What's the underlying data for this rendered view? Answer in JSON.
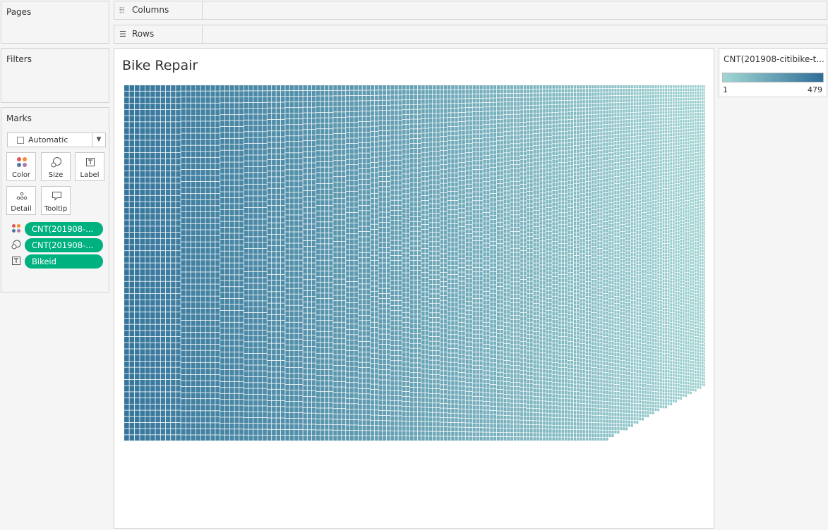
{
  "pages": {
    "title": "Pages"
  },
  "filters": {
    "title": "Filters"
  },
  "shelves": {
    "columns": "Columns",
    "rows": "Rows"
  },
  "marks": {
    "title": "Marks",
    "mark_type": "Automatic",
    "buttons": {
      "color": "Color",
      "size": "Size",
      "label": "Label",
      "detail": "Detail",
      "tooltip": "Tooltip"
    },
    "pills": [
      {
        "encoding": "color",
        "label": "CNT(201908-..."
      },
      {
        "encoding": "size",
        "label": "CNT(201908-..."
      },
      {
        "encoding": "label",
        "label": "Bikeid"
      }
    ]
  },
  "sheet": {
    "title": "Bike Repair"
  },
  "legend": {
    "title": "CNT(201908-citibike-t...",
    "min": "1",
    "max": "479",
    "color_low": "#a3d7d3",
    "color_high": "#2d6e97"
  },
  "accent_colors": {
    "pill": "#00b180"
  },
  "chart_data": {
    "type": "treemap",
    "measure": "CNT(201908-citibike-t...",
    "dimension": "Bikeid",
    "color_range": [
      1,
      479
    ]
  }
}
